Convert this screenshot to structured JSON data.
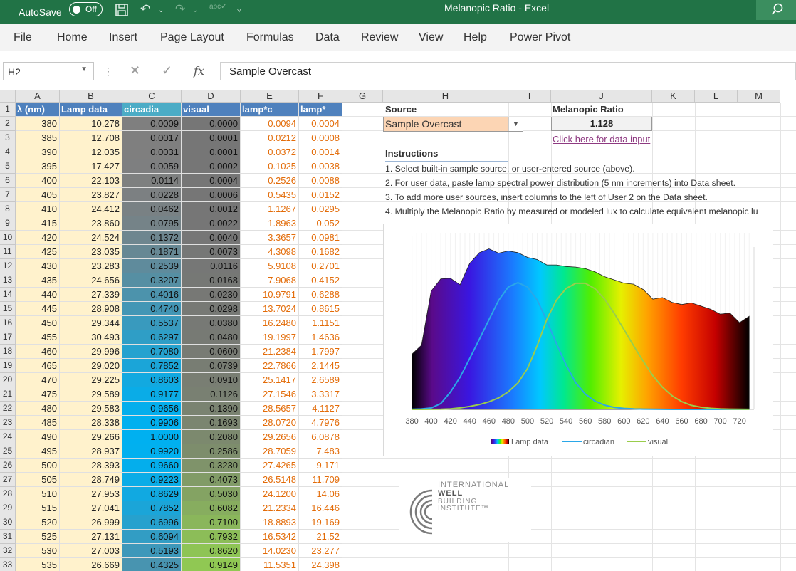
{
  "titlebar": {
    "autosave": "AutoSave",
    "toggle": "Off",
    "title": "Melanopic Ratio  -  Excel"
  },
  "ribbon": [
    "File",
    "Home",
    "Insert",
    "Page Layout",
    "Formulas",
    "Data",
    "Review",
    "View",
    "Help",
    "Power Pivot"
  ],
  "formula_bar": {
    "name_box": "H2",
    "fx": "fx",
    "value": "Sample Overcast"
  },
  "columns": [
    "A",
    "B",
    "C",
    "D",
    "E",
    "F",
    "G",
    "H",
    "I",
    "J",
    "K",
    "L",
    "M"
  ],
  "table_headers": [
    "λ (nm)",
    "Lamp data",
    "circadia",
    "visual",
    "lamp*c",
    "lamp*"
  ],
  "rows": [
    {
      "r": "2",
      "A": "380",
      "B": "10.278",
      "C": "0.0009",
      "D": "0.0000",
      "E": "0.0094",
      "F": "0.0004"
    },
    {
      "r": "3",
      "A": "385",
      "B": "12.708",
      "C": "0.0017",
      "D": "0.0001",
      "E": "0.0212",
      "F": "0.0008"
    },
    {
      "r": "4",
      "A": "390",
      "B": "12.035",
      "C": "0.0031",
      "D": "0.0001",
      "E": "0.0372",
      "F": "0.0014"
    },
    {
      "r": "5",
      "A": "395",
      "B": "17.427",
      "C": "0.0059",
      "D": "0.0002",
      "E": "0.1025",
      "F": "0.0038"
    },
    {
      "r": "6",
      "A": "400",
      "B": "22.103",
      "C": "0.0114",
      "D": "0.0004",
      "E": "0.2526",
      "F": "0.0088"
    },
    {
      "r": "7",
      "A": "405",
      "B": "23.827",
      "C": "0.0228",
      "D": "0.0006",
      "E": "0.5435",
      "F": "0.0152"
    },
    {
      "r": "8",
      "A": "410",
      "B": "24.412",
      "C": "0.0462",
      "D": "0.0012",
      "E": "1.1267",
      "F": "0.0295"
    },
    {
      "r": "9",
      "A": "415",
      "B": "23.860",
      "C": "0.0795",
      "D": "0.0022",
      "E": "1.8963",
      "F": "0.052"
    },
    {
      "r": "10",
      "A": "420",
      "B": "24.524",
      "C": "0.1372",
      "D": "0.0040",
      "E": "3.3657",
      "F": "0.0981"
    },
    {
      "r": "11",
      "A": "425",
      "B": "23.035",
      "C": "0.1871",
      "D": "0.0073",
      "E": "4.3098",
      "F": "0.1682"
    },
    {
      "r": "12",
      "A": "430",
      "B": "23.283",
      "C": "0.2539",
      "D": "0.0116",
      "E": "5.9108",
      "F": "0.2701"
    },
    {
      "r": "13",
      "A": "435",
      "B": "24.656",
      "C": "0.3207",
      "D": "0.0168",
      "E": "7.9068",
      "F": "0.4152"
    },
    {
      "r": "14",
      "A": "440",
      "B": "27.339",
      "C": "0.4016",
      "D": "0.0230",
      "E": "10.9791",
      "F": "0.6288"
    },
    {
      "r": "15",
      "A": "445",
      "B": "28.908",
      "C": "0.4740",
      "D": "0.0298",
      "E": "13.7024",
      "F": "0.8615"
    },
    {
      "r": "16",
      "A": "450",
      "B": "29.344",
      "C": "0.5537",
      "D": "0.0380",
      "E": "16.2480",
      "F": "1.1151"
    },
    {
      "r": "17",
      "A": "455",
      "B": "30.493",
      "C": "0.6297",
      "D": "0.0480",
      "E": "19.1997",
      "F": "1.4636"
    },
    {
      "r": "18",
      "A": "460",
      "B": "29.996",
      "C": "0.7080",
      "D": "0.0600",
      "E": "21.2384",
      "F": "1.7997"
    },
    {
      "r": "19",
      "A": "465",
      "B": "29.020",
      "C": "0.7852",
      "D": "0.0739",
      "E": "22.7866",
      "F": "2.1445"
    },
    {
      "r": "20",
      "A": "470",
      "B": "29.225",
      "C": "0.8603",
      "D": "0.0910",
      "E": "25.1417",
      "F": "2.6589"
    },
    {
      "r": "21",
      "A": "475",
      "B": "29.589",
      "C": "0.9177",
      "D": "0.1126",
      "E": "27.1546",
      "F": "3.3317"
    },
    {
      "r": "22",
      "A": "480",
      "B": "29.583",
      "C": "0.9656",
      "D": "0.1390",
      "E": "28.5657",
      "F": "4.1127"
    },
    {
      "r": "23",
      "A": "485",
      "B": "28.338",
      "C": "0.9906",
      "D": "0.1693",
      "E": "28.0720",
      "F": "4.7976"
    },
    {
      "r": "24",
      "A": "490",
      "B": "29.266",
      "C": "1.0000",
      "D": "0.2080",
      "E": "29.2656",
      "F": "6.0878"
    },
    {
      "r": "25",
      "A": "495",
      "B": "28.937",
      "C": "0.9920",
      "D": "0.2586",
      "E": "28.7059",
      "F": "7.483"
    },
    {
      "r": "26",
      "A": "500",
      "B": "28.393",
      "C": "0.9660",
      "D": "0.3230",
      "E": "27.4265",
      "F": "9.171"
    },
    {
      "r": "27",
      "A": "505",
      "B": "28.749",
      "C": "0.9223",
      "D": "0.4073",
      "E": "26.5148",
      "F": "11.709"
    },
    {
      "r": "28",
      "A": "510",
      "B": "27.953",
      "C": "0.8629",
      "D": "0.5030",
      "E": "24.1200",
      "F": "14.06"
    },
    {
      "r": "29",
      "A": "515",
      "B": "27.041",
      "C": "0.7852",
      "D": "0.6082",
      "E": "21.2334",
      "F": "16.446"
    },
    {
      "r": "30",
      "A": "520",
      "B": "26.999",
      "C": "0.6996",
      "D": "0.7100",
      "E": "18.8893",
      "F": "19.169"
    },
    {
      "r": "31",
      "A": "525",
      "B": "27.131",
      "C": "0.6094",
      "D": "0.7932",
      "E": "16.5342",
      "F": "21.52"
    },
    {
      "r": "32",
      "A": "530",
      "B": "27.003",
      "C": "0.5193",
      "D": "0.8620",
      "E": "14.0230",
      "F": "23.277"
    },
    {
      "r": "33",
      "A": "535",
      "B": "26.669",
      "C": "0.4325",
      "D": "0.9149",
      "E": "11.5351",
      "F": "24.398"
    }
  ],
  "source": {
    "label": "Source",
    "value": "Sample Overcast"
  },
  "ratio": {
    "label": "Melanopic Ratio",
    "value": "1.128",
    "link": "Click here for data input"
  },
  "instructions": {
    "title": "Instructions",
    "lines": [
      "1. Select built-in sample source, or user-entered source (above).",
      "2. For user data, paste lamp spectral power distribution (5 nm increments) into Data sheet.",
      "3. To add more user sources, insert columns to the left of User 2 on the Data sheet.",
      "4. Multiply the Melanopic Ratio by measured or modeled lux to calculate equivalent melanopic lu"
    ]
  },
  "logo": {
    "l1": "INTERNATIONAL",
    "l2": "WELL",
    "l3": "BUILDING",
    "l4": "INSTITUTE™"
  },
  "chart_data": {
    "type": "area",
    "x": [
      380,
      390,
      400,
      410,
      420,
      430,
      440,
      450,
      460,
      470,
      480,
      490,
      500,
      510,
      520,
      530,
      540,
      550,
      560,
      570,
      580,
      590,
      600,
      610,
      620,
      630,
      640,
      650,
      660,
      670,
      680,
      690,
      700,
      710,
      720,
      730
    ],
    "xticks": [
      380,
      400,
      420,
      440,
      460,
      480,
      500,
      520,
      540,
      560,
      580,
      600,
      620,
      640,
      660,
      680,
      700,
      720
    ],
    "series": [
      {
        "name": "Lamp data",
        "values": [
          10.3,
          12.0,
          22.1,
          24.4,
          24.5,
          23.3,
          27.3,
          29.3,
          30.0,
          29.2,
          29.6,
          29.3,
          28.4,
          28.0,
          27.0,
          27.0,
          26.7,
          26.6,
          26.3,
          25.7,
          24.8,
          24.2,
          23.6,
          23.4,
          22.4,
          20.6,
          20.9,
          20.0,
          19.6,
          19.9,
          19.3,
          18.7,
          17.8,
          18.0,
          16.2,
          17.4
        ]
      },
      {
        "name": "circadian",
        "values": [
          0.0009,
          0.0031,
          0.0114,
          0.0462,
          0.1372,
          0.2539,
          0.4016,
          0.5537,
          0.708,
          0.8603,
          0.9656,
          1.0,
          0.966,
          0.8629,
          0.6996,
          0.5193,
          0.35,
          0.21,
          0.12,
          0.065,
          0.033,
          0.016,
          0.008,
          0.004,
          0.002,
          0.001,
          0.0005,
          0.0002,
          0.0001,
          0.0,
          0.0,
          0.0,
          0.0,
          0.0,
          0.0,
          0.0
        ]
      },
      {
        "name": "visual",
        "values": [
          0.0,
          0.0001,
          0.0004,
          0.0012,
          0.004,
          0.0116,
          0.023,
          0.038,
          0.06,
          0.091,
          0.139,
          0.208,
          0.323,
          0.503,
          0.71,
          0.862,
          0.954,
          0.995,
          0.995,
          0.952,
          0.87,
          0.757,
          0.631,
          0.503,
          0.381,
          0.265,
          0.175,
          0.107,
          0.061,
          0.032,
          0.017,
          0.0082,
          0.0041,
          0.0021,
          0.001,
          0.0005
        ]
      }
    ],
    "legend": "bottom"
  }
}
